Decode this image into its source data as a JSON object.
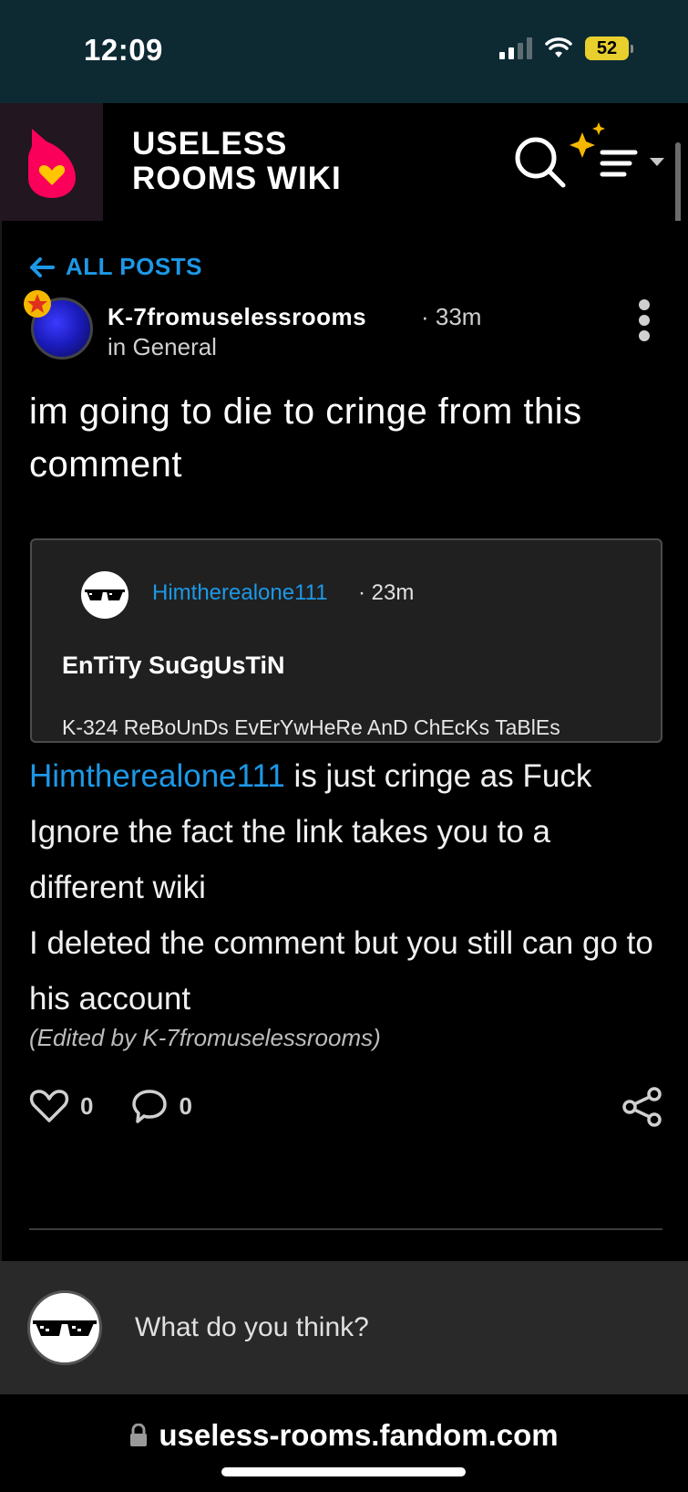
{
  "status_bar": {
    "time": "12:09",
    "battery": "52"
  },
  "header": {
    "wiki_title_line1": "USELESS",
    "wiki_title_line2": "ROOMS WIKI",
    "brand_color": "#fa005a",
    "logo_icon": "fandom-flame-icon",
    "search_icon": "search-icon",
    "menu_icon": "sparkle-menu-icon"
  },
  "post": {
    "back_label": "ALL POSTS",
    "author": "K-7fromuselessrooms",
    "time": "· 33m",
    "category": "in General",
    "title": "im going to die to cringe from this comment",
    "embed": {
      "user": "Himtherealone111",
      "time": "· 23m",
      "title": "EnTiTy SuGgUsTiN",
      "body": "K-324 ReBoUnDs EvErYwHeRe AnD ChEcKs TaBlEs"
    },
    "body": {
      "mention": "Himtherealone111",
      "line1_rest": " is just cringe as Fuck",
      "line2": "Ignore the fact the link takes you to a different wiki",
      "line3": "I deleted the comment but you still can go to his account"
    },
    "edited_note": "(Edited by K-7fromuselessrooms)",
    "likes": "0",
    "comments": "0"
  },
  "reply": {
    "placeholder": "What do you think?"
  },
  "browser": {
    "url": "useless-rooms.fandom.com"
  },
  "colors": {
    "link": "#1d98e6",
    "status_bar_bg": "#0d2a33",
    "battery": "#e8cf2e"
  }
}
